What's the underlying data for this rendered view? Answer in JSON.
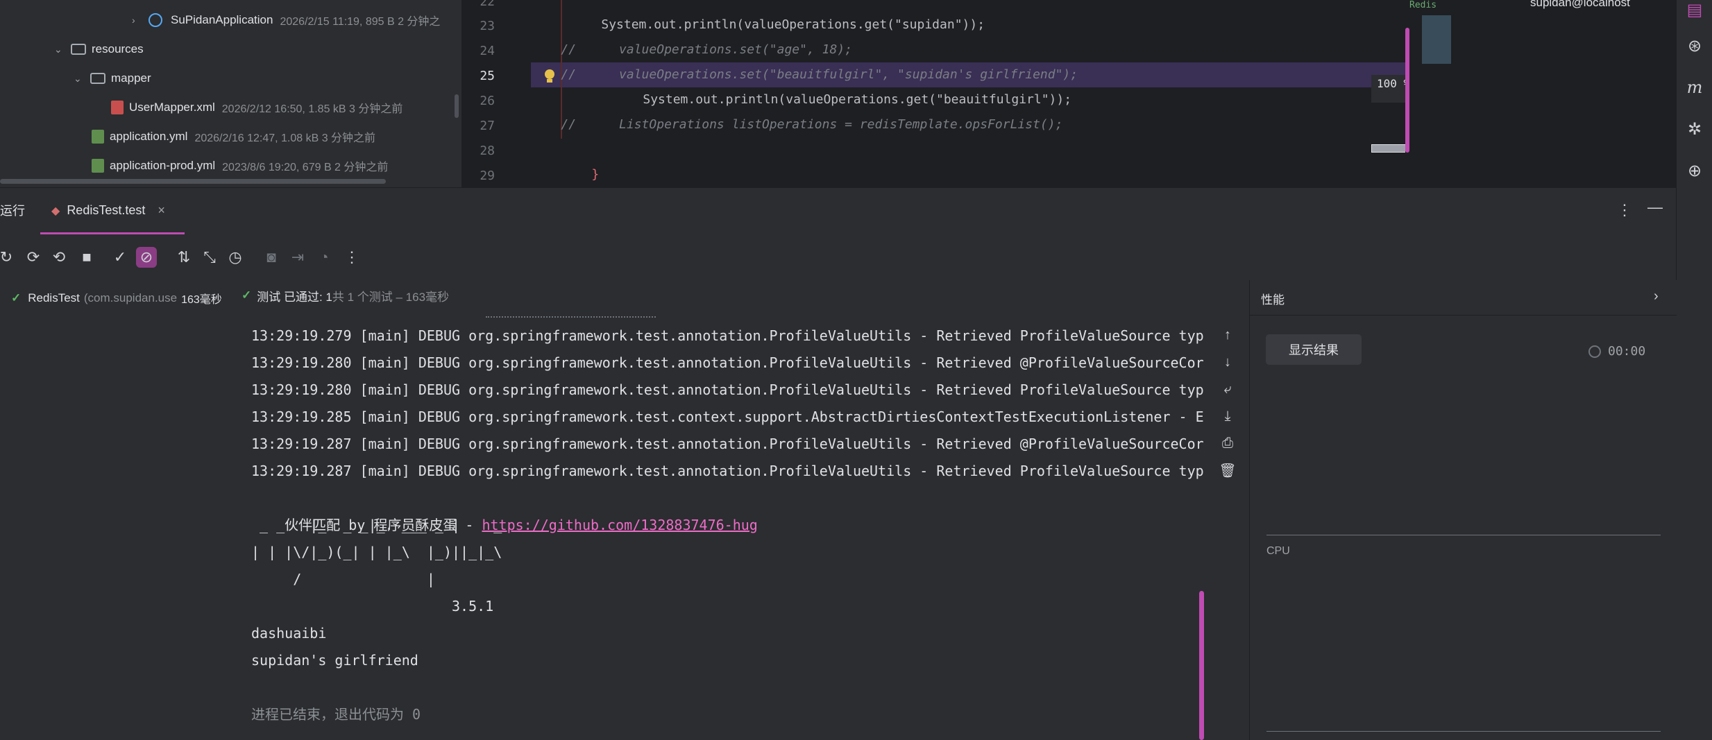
{
  "project_tree": [
    {
      "name": "SuPidanApplication",
      "meta": "2026/2/15 11:19, 895 B 2 分钟之"
    },
    {
      "name": "resources",
      "meta": ""
    },
    {
      "name": "mapper",
      "meta": ""
    },
    {
      "name": "UserMapper.xml",
      "meta": "2026/2/12 16:50, 1.85 kB 3 分钟之前"
    },
    {
      "name": "application.yml",
      "meta": "2026/2/16 12:47, 1.08 kB 3 分钟之前"
    },
    {
      "name": "application-prod.yml",
      "meta": "2023/8/6 19:20, 679 B 2 分钟之前"
    }
  ],
  "editor": {
    "line_numbers": [
      "22",
      "23",
      "24",
      "25",
      "26",
      "27",
      "28",
      "29"
    ],
    "lines": [
      {
        "prefix": "",
        "code": "System.out.println(valueOperations.get(\"supidan\"));"
      },
      {
        "prefix": "//",
        "code": "valueOperations.set(\"age\", 18);"
      },
      {
        "prefix": "//",
        "code": "valueOperations.set(\"beauitfulgirl\", \"supidan's girlfriend\");"
      },
      {
        "prefix": "",
        "code": "System.out.println(valueOperations.get(\"beauitfulgirl\"));"
      },
      {
        "prefix": "//",
        "code": "ListOperations listOperations = redisTemplate.opsForList();"
      },
      {
        "prefix": "",
        "code": ""
      },
      {
        "prefix": "",
        "code": "}"
      },
      {
        "prefix": "",
        "code": "}"
      }
    ],
    "zoom_hint": "100 %",
    "minimap_label": "Redis"
  },
  "db_panel": {
    "item": "supidan@localhost"
  },
  "run_window": {
    "label": "运行",
    "tab": "RedisTest.test"
  },
  "test_tree": {
    "item_name": "RedisTest",
    "item_pkg": "(com.supidan.use",
    "item_time": "163毫秒"
  },
  "status": {
    "prefix": "测试 已通过: 1",
    "suffix": "共 1 个测试 – 163毫秒"
  },
  "console": {
    "lines": [
      "13:29:19.279 [main] DEBUG org.springframework.test.annotation.ProfileValueUtils - Retrieved ProfileValueSource typ",
      "13:29:19.280 [main] DEBUG org.springframework.test.annotation.ProfileValueUtils - Retrieved @ProfileValueSourceCor",
      "13:29:19.280 [main] DEBUG org.springframework.test.annotation.ProfileValueUtils - Retrieved ProfileValueSource typ",
      "13:29:19.285 [main] DEBUG org.springframework.test.context.support.AbstractDirtiesContextTestExecutionListener - E",
      "13:29:19.287 [main] DEBUG org.springframework.test.annotation.ProfileValueUtils - Retrieved @ProfileValueSourceCor",
      "13:29:19.287 [main] DEBUG org.springframework.test.annotation.ProfileValueUtils - Retrieved ProfileValueSource typ"
    ],
    "partner_text": "伙伴匹配 by 程序员酥皮蛋 - ",
    "partner_link": "https://github.com/1328837476-hug",
    "banner": [
      " _ _   |_  _ _|_. ___ _ |    _",
      "| | |\\/|_)(_| | |_\\  |_)||_|_\\",
      "     /               |",
      "                        3.5.1"
    ],
    "output_1": "dashuaibi",
    "output_2": "supidan's girlfriend",
    "exit_text": "进程已结束，退出代码为 0"
  },
  "performance": {
    "title": "性能",
    "show_results": "显示结果",
    "timer": "00:00",
    "cpu_label": "CPU"
  }
}
